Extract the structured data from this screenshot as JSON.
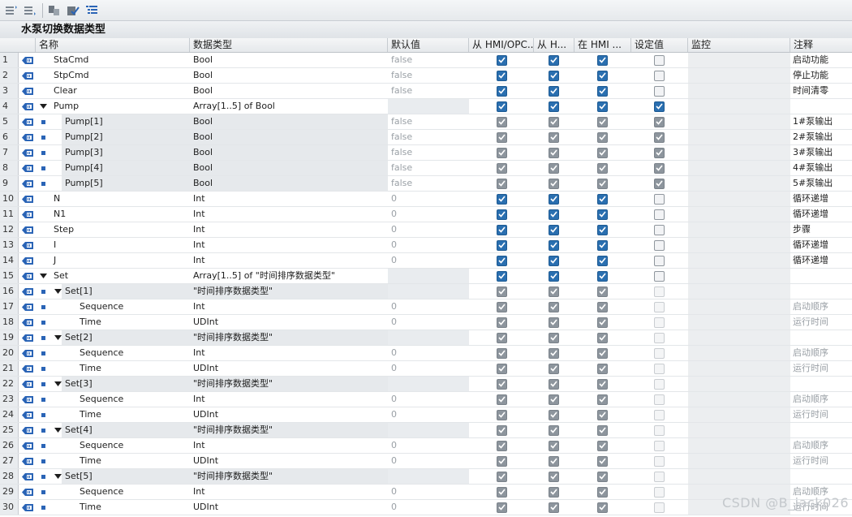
{
  "toolbar": {
    "buttons": [
      {
        "name": "insert-row-icon"
      },
      {
        "name": "add-row-icon"
      },
      {
        "name": "expand-all-icon"
      },
      {
        "name": "keep-values-icon"
      },
      {
        "name": "show-list-icon"
      }
    ]
  },
  "title": "水泵切换数据类型",
  "columns": {
    "name": "名称",
    "type": "数据类型",
    "default": "默认值",
    "hmi_opc": "从 HMI/OPC...",
    "from_h": "从 H...",
    "in_hmi": "在 HMI ...",
    "setpoint": "设定值",
    "monitor": "监控",
    "comment": "注释"
  },
  "rows": [
    {
      "no": "1",
      "name": "StaCmd",
      "type": "Bool",
      "default": "false",
      "c1": "on",
      "c2": "on",
      "c3": "on",
      "c4": "off",
      "comment": "启动功能",
      "indent": 0,
      "exp": "",
      "sq": false,
      "hl": false,
      "grey": false
    },
    {
      "no": "2",
      "name": "StpCmd",
      "type": "Bool",
      "default": "false",
      "c1": "on",
      "c2": "on",
      "c3": "on",
      "c4": "off",
      "comment": "停止功能",
      "indent": 0,
      "exp": "",
      "sq": false,
      "hl": false,
      "grey": false
    },
    {
      "no": "3",
      "name": "Clear",
      "type": "Bool",
      "default": "false",
      "c1": "on",
      "c2": "on",
      "c3": "on",
      "c4": "off",
      "comment": "时间清零",
      "indent": 0,
      "exp": "",
      "sq": false,
      "hl": false,
      "grey": false
    },
    {
      "no": "4",
      "name": "Pump",
      "type": "Array[1..5] of Bool",
      "default": "",
      "c1": "on",
      "c2": "on",
      "c3": "on",
      "c4": "on",
      "comment": "",
      "indent": 0,
      "exp": "down",
      "sq": false,
      "hl": false,
      "grey": false
    },
    {
      "no": "5",
      "name": "Pump[1]",
      "type": "Bool",
      "default": "false",
      "c1": "on-dim",
      "c2": "on-dim",
      "c3": "on-dim",
      "c4": "on-dim",
      "comment": "1#泵输出",
      "indent": 1,
      "exp": "",
      "sq": true,
      "hl": true,
      "grey": false
    },
    {
      "no": "6",
      "name": "Pump[2]",
      "type": "Bool",
      "default": "false",
      "c1": "on-dim",
      "c2": "on-dim",
      "c3": "on-dim",
      "c4": "on-dim",
      "comment": "2#泵输出",
      "indent": 1,
      "exp": "",
      "sq": true,
      "hl": true,
      "grey": false
    },
    {
      "no": "7",
      "name": "Pump[3]",
      "type": "Bool",
      "default": "false",
      "c1": "on-dim",
      "c2": "on-dim",
      "c3": "on-dim",
      "c4": "on-dim",
      "comment": "3#泵输出",
      "indent": 1,
      "exp": "",
      "sq": true,
      "hl": true,
      "grey": false
    },
    {
      "no": "8",
      "name": "Pump[4]",
      "type": "Bool",
      "default": "false",
      "c1": "on-dim",
      "c2": "on-dim",
      "c3": "on-dim",
      "c4": "on-dim",
      "comment": "4#泵输出",
      "indent": 1,
      "exp": "",
      "sq": true,
      "hl": true,
      "grey": false
    },
    {
      "no": "9",
      "name": "Pump[5]",
      "type": "Bool",
      "default": "false",
      "c1": "on-dim",
      "c2": "on-dim",
      "c3": "on-dim",
      "c4": "on-dim",
      "comment": "5#泵输出",
      "indent": 1,
      "exp": "",
      "sq": true,
      "hl": true,
      "grey": false
    },
    {
      "no": "10",
      "name": "N",
      "type": "Int",
      "default": "0",
      "c1": "on",
      "c2": "on",
      "c3": "on",
      "c4": "off",
      "comment": "循环递增",
      "indent": 0,
      "exp": "",
      "sq": false,
      "hl": false,
      "grey": false
    },
    {
      "no": "11",
      "name": "N1",
      "type": "Int",
      "default": "0",
      "c1": "on",
      "c2": "on",
      "c3": "on",
      "c4": "off",
      "comment": "循环递增",
      "indent": 0,
      "exp": "",
      "sq": false,
      "hl": false,
      "grey": false
    },
    {
      "no": "12",
      "name": "Step",
      "type": "Int",
      "default": "0",
      "c1": "on",
      "c2": "on",
      "c3": "on",
      "c4": "off",
      "comment": "步骤",
      "indent": 0,
      "exp": "",
      "sq": false,
      "hl": false,
      "grey": false
    },
    {
      "no": "13",
      "name": "I",
      "type": "Int",
      "default": "0",
      "c1": "on",
      "c2": "on",
      "c3": "on",
      "c4": "off",
      "comment": "循环递增",
      "indent": 0,
      "exp": "",
      "sq": false,
      "hl": false,
      "grey": false
    },
    {
      "no": "14",
      "name": "J",
      "type": "Int",
      "default": "0",
      "c1": "on",
      "c2": "on",
      "c3": "on",
      "c4": "off",
      "comment": "循环递增",
      "indent": 0,
      "exp": "",
      "sq": false,
      "hl": false,
      "grey": false
    },
    {
      "no": "15",
      "name": "Set",
      "type": "Array[1..5] of \"时间排序数据类型\"",
      "default": "",
      "c1": "on",
      "c2": "on",
      "c3": "on",
      "c4": "off",
      "comment": "",
      "indent": 0,
      "exp": "down",
      "sq": false,
      "hl": false,
      "grey": false
    },
    {
      "no": "16",
      "name": "Set[1]",
      "type": "\"时间排序数据类型\"",
      "default": "",
      "c1": "on-dim",
      "c2": "on-dim",
      "c3": "on-dim",
      "c4": "off-dim",
      "comment": "",
      "indent": 1,
      "exp": "down",
      "sq": true,
      "hl": true,
      "grey": false
    },
    {
      "no": "17",
      "name": "Sequence",
      "type": "Int",
      "default": "0",
      "c1": "on-dim",
      "c2": "on-dim",
      "c3": "on-dim",
      "c4": "off-dim",
      "comment": "启动顺序",
      "indent": 2,
      "exp": "",
      "sq": true,
      "hl": false,
      "grey": true
    },
    {
      "no": "18",
      "name": "Time",
      "type": "UDInt",
      "default": "0",
      "c1": "on-dim",
      "c2": "on-dim",
      "c3": "on-dim",
      "c4": "off-dim",
      "comment": "运行时间",
      "indent": 2,
      "exp": "",
      "sq": true,
      "hl": false,
      "grey": true
    },
    {
      "no": "19",
      "name": "Set[2]",
      "type": "\"时间排序数据类型\"",
      "default": "",
      "c1": "on-dim",
      "c2": "on-dim",
      "c3": "on-dim",
      "c4": "off-dim",
      "comment": "",
      "indent": 1,
      "exp": "down",
      "sq": true,
      "hl": true,
      "grey": false
    },
    {
      "no": "20",
      "name": "Sequence",
      "type": "Int",
      "default": "0",
      "c1": "on-dim",
      "c2": "on-dim",
      "c3": "on-dim",
      "c4": "off-dim",
      "comment": "启动顺序",
      "indent": 2,
      "exp": "",
      "sq": true,
      "hl": false,
      "grey": true
    },
    {
      "no": "21",
      "name": "Time",
      "type": "UDInt",
      "default": "0",
      "c1": "on-dim",
      "c2": "on-dim",
      "c3": "on-dim",
      "c4": "off-dim",
      "comment": "运行时间",
      "indent": 2,
      "exp": "",
      "sq": true,
      "hl": false,
      "grey": true
    },
    {
      "no": "22",
      "name": "Set[3]",
      "type": "\"时间排序数据类型\"",
      "default": "",
      "c1": "on-dim",
      "c2": "on-dim",
      "c3": "on-dim",
      "c4": "off-dim",
      "comment": "",
      "indent": 1,
      "exp": "down",
      "sq": true,
      "hl": true,
      "grey": false
    },
    {
      "no": "23",
      "name": "Sequence",
      "type": "Int",
      "default": "0",
      "c1": "on-dim",
      "c2": "on-dim",
      "c3": "on-dim",
      "c4": "off-dim",
      "comment": "启动顺序",
      "indent": 2,
      "exp": "",
      "sq": true,
      "hl": false,
      "grey": true
    },
    {
      "no": "24",
      "name": "Time",
      "type": "UDInt",
      "default": "0",
      "c1": "on-dim",
      "c2": "on-dim",
      "c3": "on-dim",
      "c4": "off-dim",
      "comment": "运行时间",
      "indent": 2,
      "exp": "",
      "sq": true,
      "hl": false,
      "grey": true
    },
    {
      "no": "25",
      "name": "Set[4]",
      "type": "\"时间排序数据类型\"",
      "default": "",
      "c1": "on-dim",
      "c2": "on-dim",
      "c3": "on-dim",
      "c4": "off-dim",
      "comment": "",
      "indent": 1,
      "exp": "down",
      "sq": true,
      "hl": true,
      "grey": false
    },
    {
      "no": "26",
      "name": "Sequence",
      "type": "Int",
      "default": "0",
      "c1": "on-dim",
      "c2": "on-dim",
      "c3": "on-dim",
      "c4": "off-dim",
      "comment": "启动顺序",
      "indent": 2,
      "exp": "",
      "sq": true,
      "hl": false,
      "grey": true
    },
    {
      "no": "27",
      "name": "Time",
      "type": "UDInt",
      "default": "0",
      "c1": "on-dim",
      "c2": "on-dim",
      "c3": "on-dim",
      "c4": "off-dim",
      "comment": "运行时间",
      "indent": 2,
      "exp": "",
      "sq": true,
      "hl": false,
      "grey": true
    },
    {
      "no": "28",
      "name": "Set[5]",
      "type": "\"时间排序数据类型\"",
      "default": "",
      "c1": "on-dim",
      "c2": "on-dim",
      "c3": "on-dim",
      "c4": "off-dim",
      "comment": "",
      "indent": 1,
      "exp": "down",
      "sq": true,
      "hl": true,
      "grey": false
    },
    {
      "no": "29",
      "name": "Sequence",
      "type": "Int",
      "default": "0",
      "c1": "on-dim",
      "c2": "on-dim",
      "c3": "on-dim",
      "c4": "off-dim",
      "comment": "启动顺序",
      "indent": 2,
      "exp": "",
      "sq": true,
      "hl": false,
      "grey": true
    },
    {
      "no": "30",
      "name": "Time",
      "type": "UDInt",
      "default": "0",
      "c1": "on-dim",
      "c2": "on-dim",
      "c3": "on-dim",
      "c4": "off-dim",
      "comment": "运行时间",
      "indent": 2,
      "exp": "",
      "sq": true,
      "hl": false,
      "grey": true
    }
  ],
  "watermark": "CSDN @B_jack026",
  "colors": {
    "accent": "#2a6fb0",
    "tag_icon": "#2a64b6"
  }
}
